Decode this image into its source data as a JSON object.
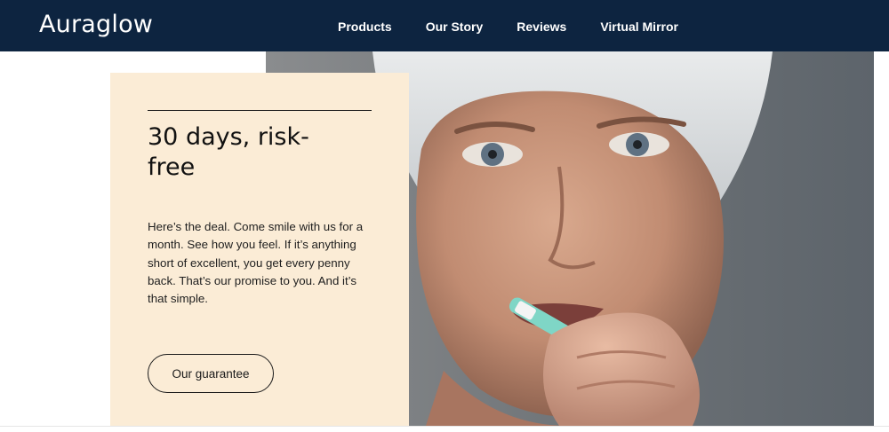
{
  "header": {
    "brand": "Auraglow",
    "nav": [
      "Products",
      "Our Story",
      "Reviews",
      "Virtual Mirror"
    ]
  },
  "promo": {
    "title": "30 days, risk-free",
    "body": "Here’s the deal. Come smile with us for a month. See how you feel. If it’s anything short of excellent, you get every penny back. That’s our promise to you. And it’s that simple.",
    "button_label": "Our guarantee"
  },
  "colors": {
    "nav_background": "#0d2440",
    "card_background": "#fbecd6",
    "toothbrush_accent": "#7fd6c6"
  }
}
